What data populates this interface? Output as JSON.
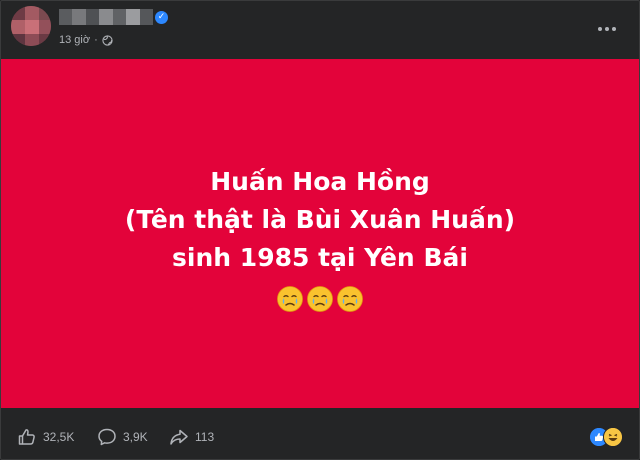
{
  "post": {
    "time": "13 giờ",
    "lines": [
      "Huấn Hoa Hồng",
      "(Tên thật là Bùi Xuân Huấn)",
      "sinh 1985 tại Yên Bái"
    ],
    "emojis": [
      "crying-face",
      "crying-face",
      "crying-face"
    ],
    "background_color": "#e3033a"
  },
  "footer": {
    "likes": "32,5K",
    "comments": "3,9K",
    "shares": "113"
  },
  "reactions": [
    "like",
    "haha"
  ]
}
